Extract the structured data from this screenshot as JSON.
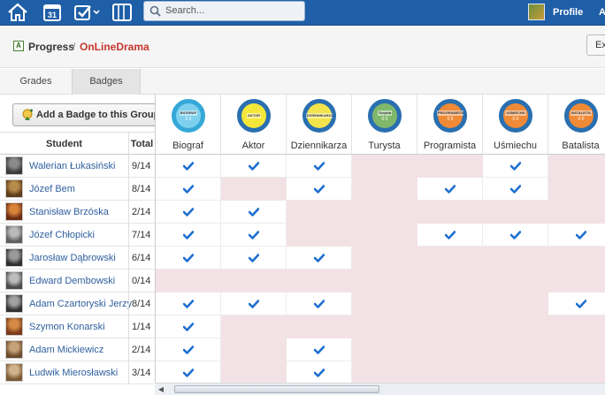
{
  "topbar": {
    "search_placeholder": "Search...",
    "profile_label": "Profile",
    "overflow_label": "A",
    "calendar_day": "31",
    "icons": [
      "home-icon",
      "calendar-icon",
      "tasks-icon",
      "notebook-icon",
      "search-icon"
    ]
  },
  "breadcrumb": {
    "section": "Progress",
    "separator": "/",
    "course": "OnLineDrama"
  },
  "export_button": "Ex",
  "tabs": [
    {
      "label": "Grades",
      "active": false
    },
    {
      "label": "Badges",
      "active": true
    }
  ],
  "add_badge_button": "Add a Badge to this Group",
  "table": {
    "student_header": "Student",
    "total_header": "Total"
  },
  "badges": [
    {
      "name": "Biograf",
      "tag": "BIOGRAF",
      "count": "0 0",
      "color": "#36a8d8",
      "inner": "#7dd0ee"
    },
    {
      "name": "Aktor",
      "tag": "AKTOR",
      "count": "",
      "color": "#2a6fb0",
      "inner": "#f5e63a"
    },
    {
      "name": "Dziennikarza",
      "tag": "DZIENNIKARZA",
      "count": "",
      "color": "#2a6fb0",
      "inner": "#f2e44a"
    },
    {
      "name": "Turysta",
      "tag": "Turysta",
      "count": "0 0",
      "color": "#2a6fb0",
      "inner": "#7fb86a"
    },
    {
      "name": "Programista",
      "tag": "PROGRAMISTA",
      "count": "0 0",
      "color": "#2a6fb0",
      "inner": "#f08a36"
    },
    {
      "name": "Uśmiechu",
      "tag": "USMIECHU",
      "count": "0 0",
      "color": "#2a6fb0",
      "inner": "#f08a36"
    },
    {
      "name": "Batalista",
      "tag": "BATALISTA",
      "count": "0 0",
      "color": "#2a6fb0",
      "inner": "#f08a36"
    }
  ],
  "students": [
    {
      "name": "Walerian Łukasiński",
      "total": "9/14",
      "awards": [
        1,
        1,
        1,
        0,
        0,
        1,
        0
      ]
    },
    {
      "name": "Józef Bem",
      "total": "8/14",
      "awards": [
        1,
        0,
        1,
        0,
        1,
        1,
        0
      ]
    },
    {
      "name": "Stanisław Brzóska",
      "total": "2/14",
      "awards": [
        1,
        1,
        0,
        0,
        0,
        0,
        0
      ]
    },
    {
      "name": "Józef Chłopicki",
      "total": "7/14",
      "awards": [
        1,
        1,
        0,
        0,
        1,
        1,
        1
      ]
    },
    {
      "name": "Jarosław Dąbrowski",
      "total": "6/14",
      "awards": [
        1,
        1,
        1,
        0,
        0,
        0,
        0
      ]
    },
    {
      "name": "Edward Dembowski",
      "total": "0/14",
      "awards": [
        0,
        0,
        0,
        0,
        0,
        0,
        0
      ]
    },
    {
      "name": "Adam Czartoryski Jerzy",
      "total": "8/14",
      "awards": [
        1,
        1,
        1,
        0,
        0,
        0,
        1
      ]
    },
    {
      "name": "Szymon Konarski",
      "total": "1/14",
      "awards": [
        1,
        0,
        0,
        0,
        0,
        0,
        0
      ]
    },
    {
      "name": "Adam Mickiewicz",
      "total": "2/14",
      "awards": [
        1,
        0,
        1,
        0,
        0,
        0,
        0
      ]
    },
    {
      "name": "Ludwik Mierosławski",
      "total": "3/14",
      "awards": [
        1,
        0,
        1,
        0,
        0,
        0,
        0
      ]
    }
  ],
  "colors": {
    "topbar": "#1f5fa8",
    "link": "#2f5f9e",
    "course": "#c8372d",
    "check": "#1e6fd0",
    "empty_cell": "#f3e2e5"
  }
}
